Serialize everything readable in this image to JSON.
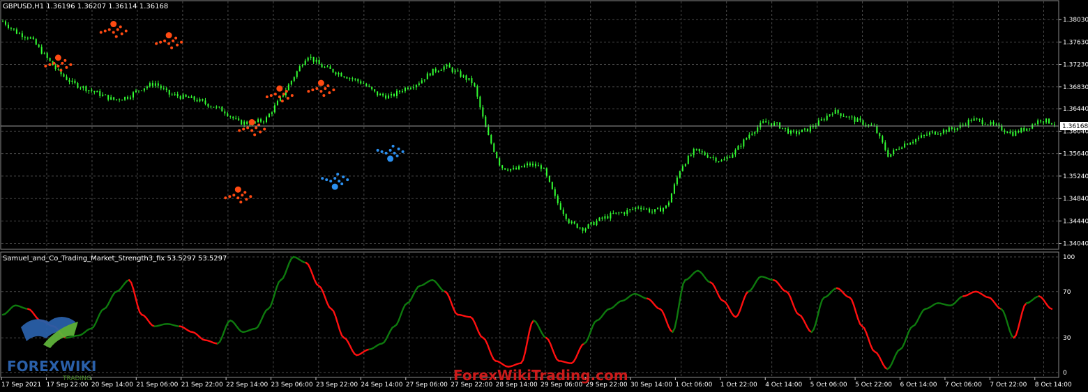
{
  "window": {
    "price_header": "GBPUSD,H1  1.36196 1.36207 1.36114 1.36168",
    "indicator_header": "Samuel_and_Co_Trading_Market_Strength3_fix 53.5297 53.5297",
    "current_price_label": "1.36168"
  },
  "colors": {
    "background": "#000000",
    "grid": "#4a4a4a",
    "candles": "#33ff33",
    "indicator_up": "#0e7a0e",
    "indicator_down": "#ff1010",
    "marker_sell": "#ff4a12",
    "marker_buy": "#2b8fef",
    "text": "#ffffff"
  },
  "icons": {
    "logo": "bull-logo-icon"
  },
  "watermark": {
    "site": "ForexWikiTrading.com",
    "logo_left": "FOREX",
    "logo_right": "WIKI",
    "logo_sub": "TRADING"
  },
  "chart_data": [
    {
      "type": "candlestick",
      "symbol": "GBPUSD",
      "timeframe": "H1",
      "ohlc_last": {
        "open": 1.36196,
        "high": 1.36207,
        "low": 1.36114,
        "close": 1.36168
      },
      "y_ticks": [
        "1.38030",
        "1.37630",
        "1.37230",
        "1.36830",
        "1.36440",
        "1.36040",
        "1.35640",
        "1.35240",
        "1.34840",
        "1.34440",
        "1.34040"
      ],
      "ylim": [
        1.3396,
        1.3818
      ],
      "grid": true,
      "x_ticks": [
        "17 Sep 2021",
        "17 Sep 22:00",
        "20 Sep 14:00",
        "21 Sep 06:00",
        "21 Sep 22:00",
        "22 Sep 14:00",
        "23 Sep 06:00",
        "23 Sep 22:00",
        "24 Sep 14:00",
        "27 Sep 06:00",
        "27 Sep 22:00",
        "28 Sep 14:00",
        "29 Sep 06:00",
        "29 Sep 22:00",
        "30 Sep 14:00",
        "1 Oct 06:00",
        "1 Oct 22:00",
        "4 Oct 14:00",
        "5 Oct 06:00",
        "5 Oct 22:00",
        "6 Oct 14:00",
        "7 Oct 06:00",
        "7 Oct 22:00",
        "8 Oct 14:00"
      ],
      "close_series": [
        1.38,
        1.378,
        1.377,
        1.374,
        1.371,
        1.369,
        1.368,
        1.367,
        1.366,
        1.3665,
        1.368,
        1.369,
        1.367,
        1.3665,
        1.366,
        1.365,
        1.364,
        1.362,
        1.3618,
        1.3625,
        1.366,
        1.37,
        1.374,
        1.372,
        1.371,
        1.37,
        1.369,
        1.367,
        1.3665,
        1.368,
        1.369,
        1.371,
        1.372,
        1.3705,
        1.369,
        1.36,
        1.354,
        1.3535,
        1.3545,
        1.354,
        1.348,
        1.344,
        1.343,
        1.3445,
        1.3455,
        1.346,
        1.347,
        1.346,
        1.347,
        1.354,
        1.357,
        1.356,
        1.355,
        1.357,
        1.36,
        1.362,
        1.3615,
        1.36,
        1.3605,
        1.362,
        1.364,
        1.363,
        1.362,
        1.361,
        1.356,
        1.358,
        1.359,
        1.36,
        1.3605,
        1.361,
        1.3625,
        1.362,
        1.361,
        1.36,
        1.361,
        1.3625,
        1.3618
      ],
      "sell_signals": [
        {
          "x_index": 4,
          "price": 1.3735
        },
        {
          "x_index": 8,
          "price": 1.3795
        },
        {
          "x_index": 12,
          "price": 1.3775
        },
        {
          "x_index": 17,
          "price": 1.35
        },
        {
          "x_index": 18,
          "price": 1.362
        },
        {
          "x_index": 20,
          "price": 1.368
        },
        {
          "x_index": 23,
          "price": 1.369
        }
      ],
      "buy_signals": [
        {
          "x_index": 24,
          "price": 1.3505
        },
        {
          "x_index": 28,
          "price": 1.3555
        }
      ]
    },
    {
      "type": "line",
      "name": "Samuel_and_Co_Trading_Market_Strength3_fix",
      "y_ticks": [
        "100",
        "70",
        "30",
        "0"
      ],
      "ylim": [
        0,
        100
      ],
      "grid": true,
      "values": [
        50,
        58,
        55,
        45,
        40,
        30,
        32,
        38,
        55,
        70,
        80,
        50,
        40,
        42,
        40,
        35,
        28,
        25,
        45,
        35,
        38,
        55,
        80,
        100,
        95,
        75,
        55,
        30,
        15,
        20,
        25,
        40,
        60,
        75,
        80,
        70,
        50,
        48,
        30,
        10,
        5,
        8,
        45,
        30,
        10,
        8,
        25,
        45,
        55,
        62,
        68,
        64,
        55,
        35,
        80,
        88,
        78,
        62,
        48,
        70,
        83,
        80,
        70,
        50,
        35,
        65,
        73,
        65,
        40,
        18,
        3,
        20,
        40,
        55,
        60,
        58,
        66,
        70,
        65,
        55,
        30,
        60,
        66,
        55
      ],
      "down_ranges": [
        [
          2,
          5
        ],
        [
          10,
          12
        ],
        [
          14,
          17
        ],
        [
          24,
          29
        ],
        [
          35,
          42
        ],
        [
          43,
          46
        ],
        [
          51,
          53
        ],
        [
          56,
          59
        ],
        [
          61,
          64
        ],
        [
          66,
          70
        ],
        [
          76,
          79
        ],
        [
          80,
          81
        ],
        [
          82,
          84
        ]
      ]
    }
  ]
}
